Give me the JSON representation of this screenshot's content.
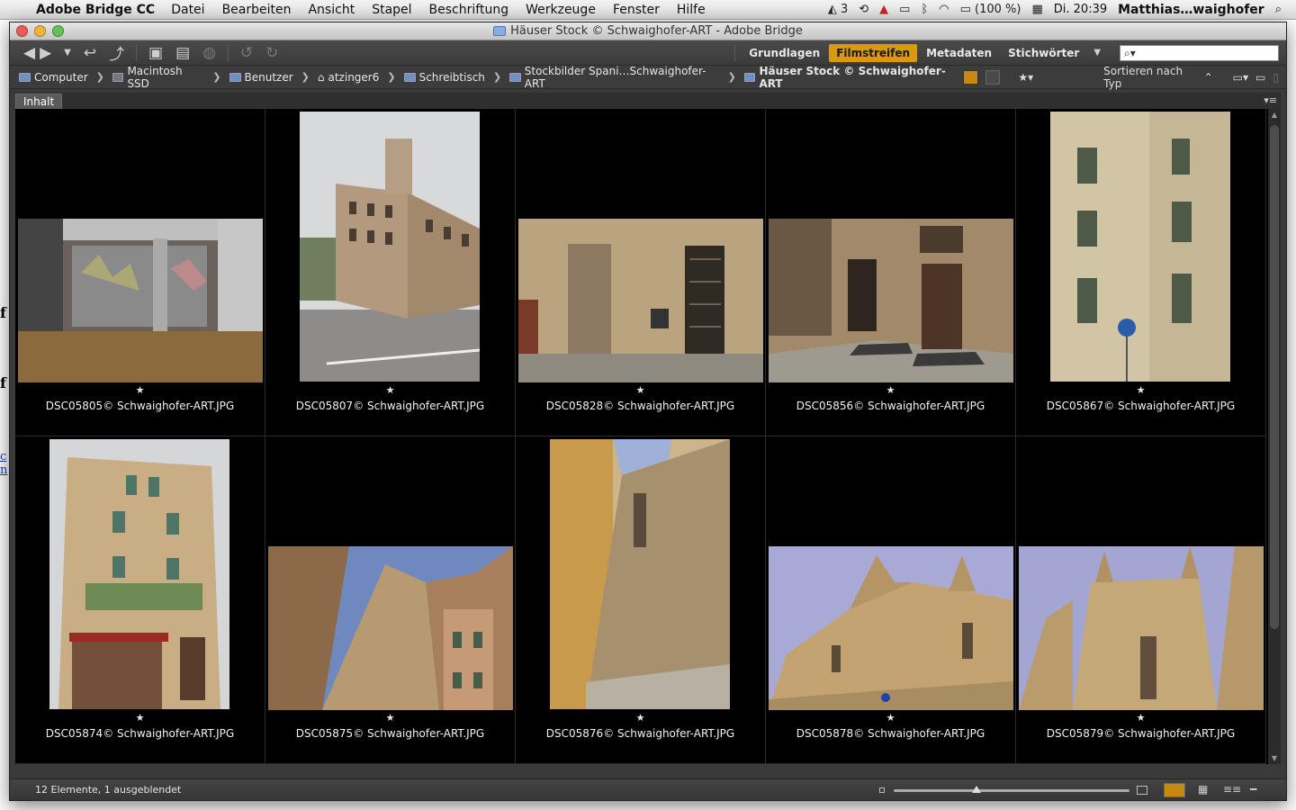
{
  "menubar": {
    "app_name": "Adobe Bridge CC",
    "menus": [
      "Datei",
      "Bearbeiten",
      "Ansicht",
      "Stapel",
      "Beschriftung",
      "Werkzeuge",
      "Fenster",
      "Hilfe"
    ],
    "battery": "(100 %)",
    "clock": "Di. 20:39",
    "user": "Matthias…waighofer",
    "adobe_count": "3"
  },
  "window": {
    "title": "Häuser Stock © Schwaighofer-ART - Adobe Bridge"
  },
  "toolbar": {
    "workspaces": [
      {
        "label": "Grundlagen",
        "active": false
      },
      {
        "label": "Filmstreifen",
        "active": true
      },
      {
        "label": "Metadaten",
        "active": false
      },
      {
        "label": "Stichwörter",
        "active": false
      }
    ],
    "search_placeholder": ""
  },
  "path": {
    "crumbs": [
      {
        "label": "Computer",
        "icon": "computer-icon"
      },
      {
        "label": "Macintosh SSD",
        "icon": "drive-icon"
      },
      {
        "label": "Benutzer",
        "icon": "folder-icon"
      },
      {
        "label": "atzinger6",
        "icon": "home-icon"
      },
      {
        "label": "Schreibtisch",
        "icon": "folder-icon"
      },
      {
        "label": "Stockbilder Spani…Schwaighofer-ART",
        "icon": "folder-icon"
      },
      {
        "label": "Häuser Stock © Schwaighofer-ART",
        "icon": "folder-icon"
      }
    ],
    "sort_label": "Sortieren nach Typ"
  },
  "panel": {
    "tab_label": "Inhalt"
  },
  "items": [
    {
      "filename": "DSC05805© Schwaighofer-ART.JPG",
      "rating": "★",
      "orientation": "landscape"
    },
    {
      "filename": "DSC05807© Schwaighofer-ART.JPG",
      "rating": "★",
      "orientation": "portrait"
    },
    {
      "filename": "DSC05828© Schwaighofer-ART.JPG",
      "rating": "★",
      "orientation": "landscape"
    },
    {
      "filename": "DSC05856© Schwaighofer-ART.JPG",
      "rating": "★",
      "orientation": "landscape"
    },
    {
      "filename": "DSC05867© Schwaighofer-ART.JPG",
      "rating": "★",
      "orientation": "portrait"
    },
    {
      "filename": "DSC05874© Schwaighofer-ART.JPG",
      "rating": "★",
      "orientation": "portrait"
    },
    {
      "filename": "DSC05875© Schwaighofer-ART.JPG",
      "rating": "★",
      "orientation": "landscape"
    },
    {
      "filename": "DSC05876© Schwaighofer-ART.JPG",
      "rating": "★",
      "orientation": "portrait"
    },
    {
      "filename": "DSC05878© Schwaighofer-ART.JPG",
      "rating": "★",
      "orientation": "landscape"
    },
    {
      "filename": "DSC05879© Schwaighofer-ART.JPG",
      "rating": "★",
      "orientation": "landscape"
    }
  ],
  "status": {
    "text": "12 Elemente, 1 ausgeblendet",
    "zoom_fraction": 0.35
  },
  "colors": {
    "accent": "#d99a0e",
    "panel_bg": "#3a3a3a",
    "content_bg": "#000000"
  }
}
